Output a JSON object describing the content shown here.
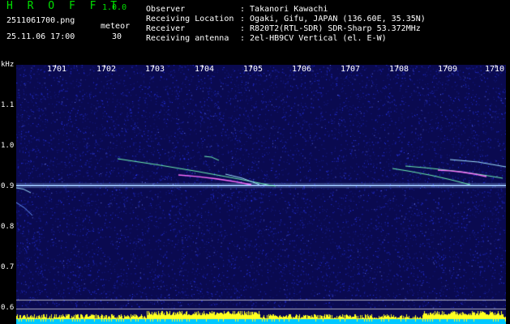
{
  "app": {
    "name": "H R O F F T",
    "version": "1.0.0"
  },
  "file": {
    "name": "2511061700.png",
    "datetime": "25.11.06 17:00"
  },
  "meteor": {
    "label": "meteor",
    "count": "30"
  },
  "station": [
    {
      "label": "Observer",
      "value": ": Takanori Kawachi"
    },
    {
      "label": "Receiving Location",
      "value": ": Ogaki, Gifu, JAPAN (136.60E, 35.35N)"
    },
    {
      "label": "Receiver",
      "value": ": R820T2(RTL-SDR) SDR-Sharp 53.372MHz"
    },
    {
      "label": "Receiving antenna",
      "value": ": 2el-HB9CV Vertical (el. E-W)"
    }
  ],
  "axis": {
    "y_unit": "kHz",
    "y_ticks": [
      "1.1",
      "1.0",
      "0.9",
      "0.8",
      "0.7",
      "0.6"
    ],
    "x_ticks": [
      "1701",
      "1702",
      "1703",
      "1704",
      "1705",
      "1706",
      "1707",
      "1708",
      "1709",
      "1710"
    ]
  },
  "colors": {
    "background": "#0a0a50",
    "noise": "#2a3aff",
    "carrier": "#9ec8ff",
    "trail": "#6df0b0",
    "activity": "#ffff20",
    "baseline": "#00c8ff"
  }
}
